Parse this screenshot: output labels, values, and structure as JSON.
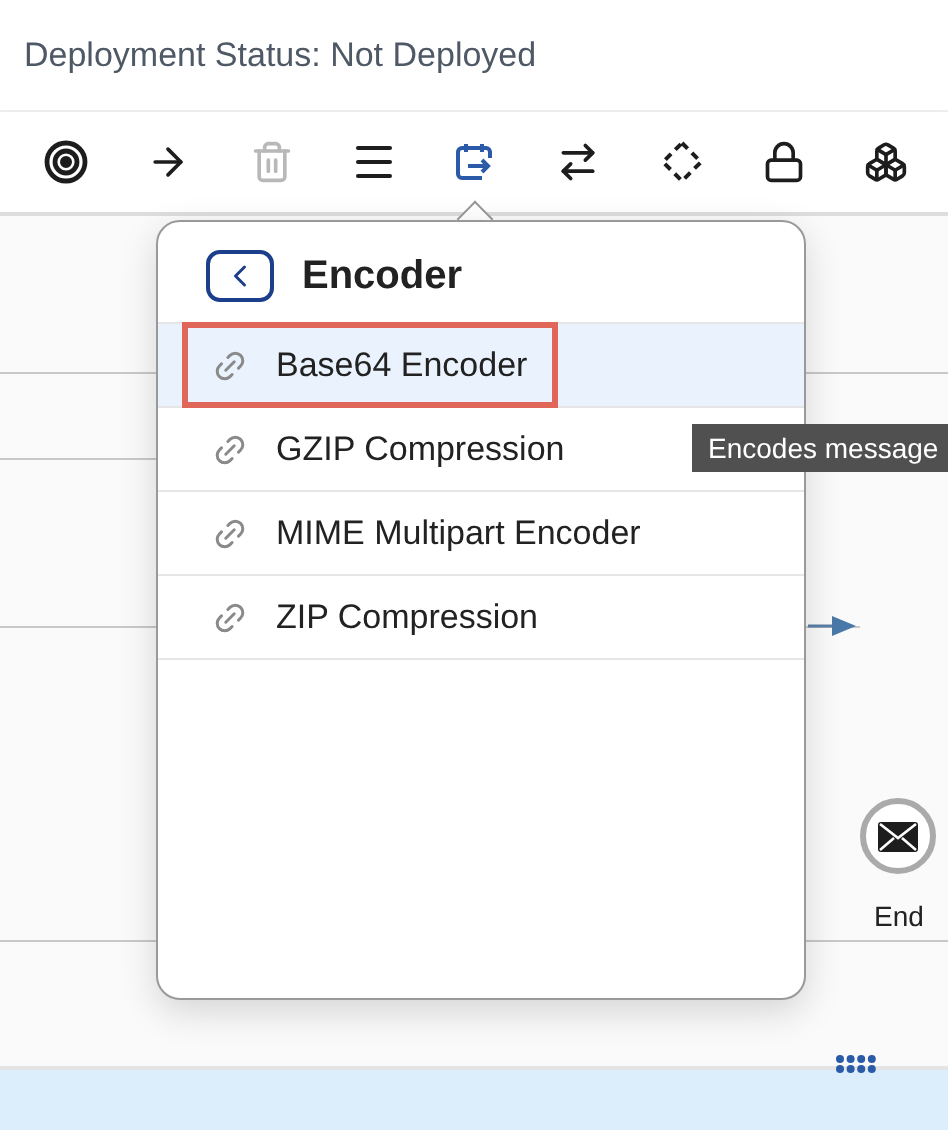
{
  "header": {
    "status": "Deployment Status: Not Deployed"
  },
  "toolbar": [
    {
      "kind": "target",
      "selected": false,
      "disabled": false
    },
    {
      "kind": "arrow",
      "selected": false,
      "disabled": false
    },
    {
      "kind": "trash",
      "selected": false,
      "disabled": true
    },
    {
      "kind": "menu",
      "selected": false,
      "disabled": false
    },
    {
      "kind": "calendar",
      "selected": true,
      "disabled": false
    },
    {
      "kind": "swap",
      "selected": false,
      "disabled": false
    },
    {
      "kind": "diamond",
      "selected": false,
      "disabled": false
    },
    {
      "kind": "lock",
      "selected": false,
      "disabled": false
    },
    {
      "kind": "cubes",
      "selected": false,
      "disabled": false
    }
  ],
  "popover": {
    "title": "Encoder",
    "items": [
      {
        "label": "Base64 Encoder",
        "selected": true,
        "highlighted": true
      },
      {
        "label": "GZIP Compression",
        "selected": false,
        "highlighted": false
      },
      {
        "label": "MIME Multipart Encoder",
        "selected": false,
        "highlighted": false
      },
      {
        "label": "ZIP Compression",
        "selected": false,
        "highlighted": false
      }
    ]
  },
  "tooltip": "Encodes message",
  "end_event": {
    "label": "End"
  }
}
